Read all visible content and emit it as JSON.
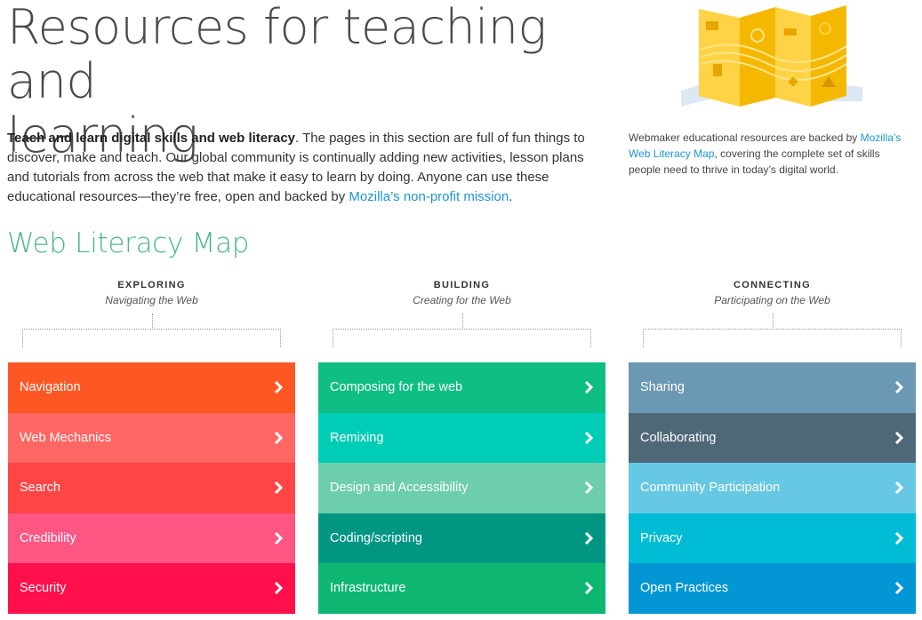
{
  "header": {
    "title_line1": "Resources for teaching and",
    "title_line2": "learning"
  },
  "intro": {
    "bold": "Teach and learn digital skills and web literacy",
    "text": ". The pages in this section are full of fun things to discover, make and teach. Our global community is continually adding new activities, lesson plans and tutorials from across the web that make it easy to learn by doing. Anyone can use these educational resources—they’re free, open and backed by ",
    "link": "Mozilla’s non-profit mission",
    "end": "."
  },
  "aside": {
    "text_before": "Webmaker educational resources are backed by ",
    "link": "Mozilla’s Web Literacy Map",
    "text_after": ", covering the complete set of skills people need to thrive in today’s digital world.",
    "illustration_icon": "folded-map-icon"
  },
  "section": {
    "heading": "Web Literacy Map"
  },
  "columns": [
    {
      "heading": "EXPLORING",
      "subheading": "Navigating the Web",
      "items": [
        {
          "label": "Navigation",
          "color": "#ff5723"
        },
        {
          "label": "Web Mechanics",
          "color": "#ff6764"
        },
        {
          "label": "Search",
          "color": "#ff4545"
        },
        {
          "label": "Credibility",
          "color": "#ff5683"
        },
        {
          "label": "Security",
          "color": "#ff0f4c"
        }
      ]
    },
    {
      "heading": "BUILDING",
      "subheading": "Creating for the Web",
      "items": [
        {
          "label": "Composing for the web",
          "color": "#0ebe83"
        },
        {
          "label": "Remixing",
          "color": "#00cdb6"
        },
        {
          "label": "Design and Accessibility",
          "color": "#6dceac"
        },
        {
          "label": "Coding/scripting",
          "color": "#009682"
        },
        {
          "label": "Infrastructure",
          "color": "#0db771"
        }
      ]
    },
    {
      "heading": "CONNECTING",
      "subheading": "Participating on the Web",
      "items": [
        {
          "label": "Sharing",
          "color": "#6b98b4"
        },
        {
          "label": "Collaborating",
          "color": "#4e6877"
        },
        {
          "label": "Community Participation",
          "color": "#67c8e4"
        },
        {
          "label": "Privacy",
          "color": "#00bcd5"
        },
        {
          "label": "Open Practices",
          "color": "#0296d4"
        }
      ]
    }
  ],
  "icons": {
    "chevron": "chevron-right-icon"
  }
}
